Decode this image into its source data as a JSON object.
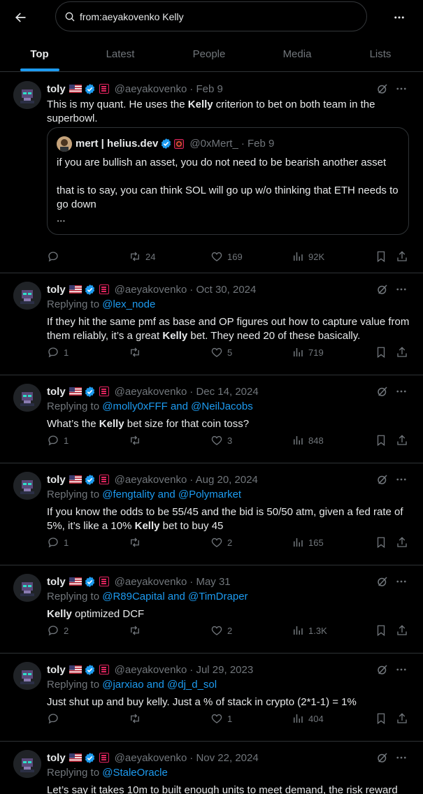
{
  "search": {
    "query": "from:aeyakovenko Kelly"
  },
  "tabs": [
    {
      "label": "Top",
      "active": true
    },
    {
      "label": "Latest",
      "active": false
    },
    {
      "label": "People",
      "active": false
    },
    {
      "label": "Media",
      "active": false
    },
    {
      "label": "Lists",
      "active": false
    }
  ],
  "colors": {
    "accent": "#1d9bf0",
    "muted": "#71767b",
    "border": "#2f3336",
    "background": "#000000"
  },
  "icons": [
    "back-arrow-icon",
    "search-icon",
    "more-icon",
    "flag-us-icon",
    "verified-icon",
    "subscriber-badge-icon",
    "grok-icon",
    "reply-icon",
    "retweet-icon",
    "like-icon",
    "views-icon",
    "bookmark-icon",
    "share-icon"
  ],
  "tweets": [
    {
      "name": "toly",
      "handle": "@aeyakovenko",
      "date": "· Feb 9",
      "replying_to": "",
      "replying_names": "",
      "text_parts": [
        "This is my quant.  He uses the ",
        "Kelly",
        " criterion to bet on both team in the superbowl."
      ],
      "quote": {
        "name": "mert | helius.dev",
        "handle": "@0xMert_",
        "date": "· Feb 9",
        "text_1": "if you are bullish an asset, you do not need to be bearish another asset",
        "text_2": "that is to say, you can think SOL will go up w/o thinking that ETH needs to go down",
        "text_3": "..."
      },
      "stats": {
        "replies": "",
        "retweets": "24",
        "likes": "169",
        "views": "92K"
      }
    },
    {
      "name": "toly",
      "handle": "@aeyakovenko",
      "date": "· Oct 30, 2024",
      "replying_to": "Replying to ",
      "replying_names": "@lex_node",
      "text_parts": [
        "If they hit the same pmf as base and OP figures out how to capture value from them reliably, it’s a great ",
        "Kelly",
        " bet.  They need 20 of these basically."
      ],
      "stats": {
        "replies": "1",
        "retweets": "",
        "likes": "5",
        "views": "719"
      }
    },
    {
      "name": "toly",
      "handle": "@aeyakovenko",
      "date": "· Dec 14, 2024",
      "replying_to": "Replying to ",
      "replying_names": "@molly0xFFF and @NeilJacobs",
      "text_parts": [
        "What’s the ",
        "Kelly",
        " bet size for that coin toss?"
      ],
      "stats": {
        "replies": "1",
        "retweets": "",
        "likes": "3",
        "views": "848"
      }
    },
    {
      "name": "toly",
      "handle": "@aeyakovenko",
      "date": "· Aug 20, 2024",
      "replying_to": "Replying to ",
      "replying_names": "@fengtality and @Polymarket",
      "text_parts": [
        "If you know the odds to be 55/45 and the bid is 50/50 atm, given a fed rate of 5%, it’s like a 10% ",
        "Kelly",
        " bet to buy 45"
      ],
      "stats": {
        "replies": "1",
        "retweets": "",
        "likes": "2",
        "views": "165"
      }
    },
    {
      "name": "toly",
      "handle": "@aeyakovenko",
      "date": "· May 31",
      "replying_to": "Replying to ",
      "replying_names": "@R89Capital and @TimDraper",
      "text_parts": [
        "",
        "Kelly",
        " optimized DCF"
      ],
      "stats": {
        "replies": "2",
        "retweets": "",
        "likes": "2",
        "views": "1.3K"
      }
    },
    {
      "name": "toly",
      "handle": "@aeyakovenko",
      "date": "· Jul 29, 2023",
      "replying_to": "Replying to ",
      "replying_names": "@jarxiao and @dj_d_sol",
      "text_parts": [
        "Just shut up and buy kelly. Just a % of stack in crypto (2*1-1) = 1%",
        "",
        ""
      ],
      "stats": {
        "replies": "",
        "retweets": "",
        "likes": "1",
        "views": "404"
      }
    },
    {
      "name": "toly",
      "handle": "@aeyakovenko",
      "date": "· Nov 22, 2024",
      "replying_to": "Replying to ",
      "replying_names": "@StaleOracle",
      "text_parts": [
        "Let’s say it takes 10m to built enough units to meet demand, the risk reward",
        "",
        ""
      ],
      "stats": {
        "replies": "",
        "retweets": "",
        "likes": "",
        "views": ""
      }
    }
  ]
}
